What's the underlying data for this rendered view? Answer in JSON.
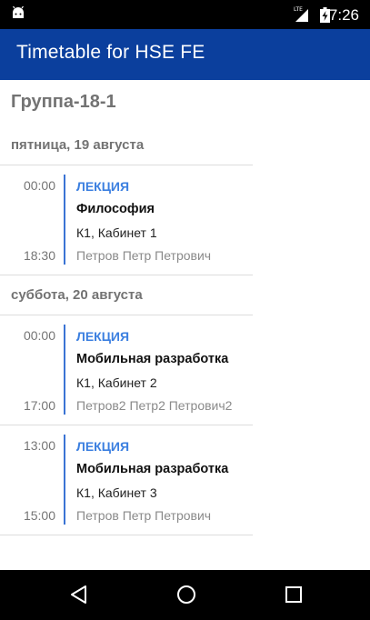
{
  "status_bar": {
    "network": "LTE",
    "time": "7:26"
  },
  "app_bar": {
    "title": "Timetable for HSE FE"
  },
  "group": {
    "title": "Группа-18-1"
  },
  "days": [
    {
      "label": "пятница, 19 августа",
      "lessons": [
        {
          "start": "00:00",
          "end": "18:30",
          "type": "ЛЕКЦИЯ",
          "subject": "Философия",
          "room": "К1, Кабинет 1",
          "teacher": "Петров Петр Петрович"
        }
      ]
    },
    {
      "label": "суббота, 20 августа",
      "lessons": [
        {
          "start": "00:00",
          "end": "17:00",
          "type": "ЛЕКЦИЯ",
          "subject": "Мобильная разработка",
          "room": "К1, Кабинет 2",
          "teacher": "Петров2 Петр2 Петрович2"
        },
        {
          "start": "13:00",
          "end": "15:00",
          "type": "ЛЕКЦИЯ",
          "subject": "Мобильная разработка",
          "room": "К1, Кабинет 3",
          "teacher": "Петров Петр Петрович"
        }
      ]
    }
  ],
  "nav_bar": {
    "icons": [
      "back-icon",
      "home-icon",
      "recents-icon"
    ]
  },
  "colors": {
    "app_bar": "#0b3f9d",
    "accent": "#3b7fe0",
    "divider": "#3a73d4"
  }
}
